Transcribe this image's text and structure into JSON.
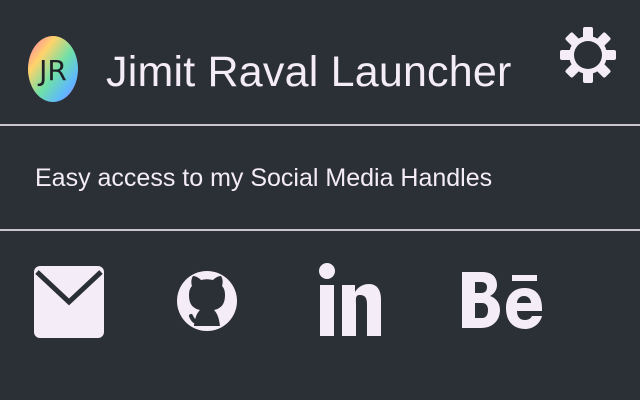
{
  "header": {
    "logo_text": "JR",
    "title": "Jimit Raval Launcher",
    "settings_icon": "gear-icon"
  },
  "tagline": "Easy access to my Social Media Handles",
  "social_links": [
    {
      "name": "email",
      "icon": "mail-icon"
    },
    {
      "name": "github",
      "icon": "github-icon"
    },
    {
      "name": "linkedin",
      "icon": "linkedin-icon"
    },
    {
      "name": "behance",
      "icon": "behance-icon"
    }
  ],
  "colors": {
    "background": "#2b2f36",
    "foreground": "#f3eaf6",
    "divider": "#c9c7cc"
  }
}
